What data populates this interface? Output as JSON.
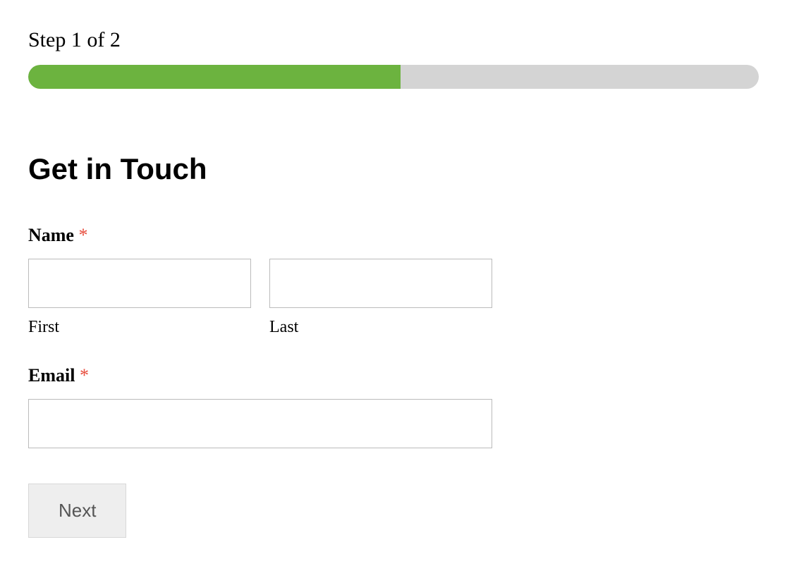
{
  "progress": {
    "step_label": "Step 1 of 2",
    "percent": 51
  },
  "form": {
    "title": "Get in Touch",
    "name": {
      "label": "Name",
      "required_marker": "*",
      "first_sublabel": "First",
      "last_sublabel": "Last",
      "first_value": "",
      "last_value": ""
    },
    "email": {
      "label": "Email",
      "required_marker": "*",
      "value": ""
    },
    "next_button": "Next"
  }
}
